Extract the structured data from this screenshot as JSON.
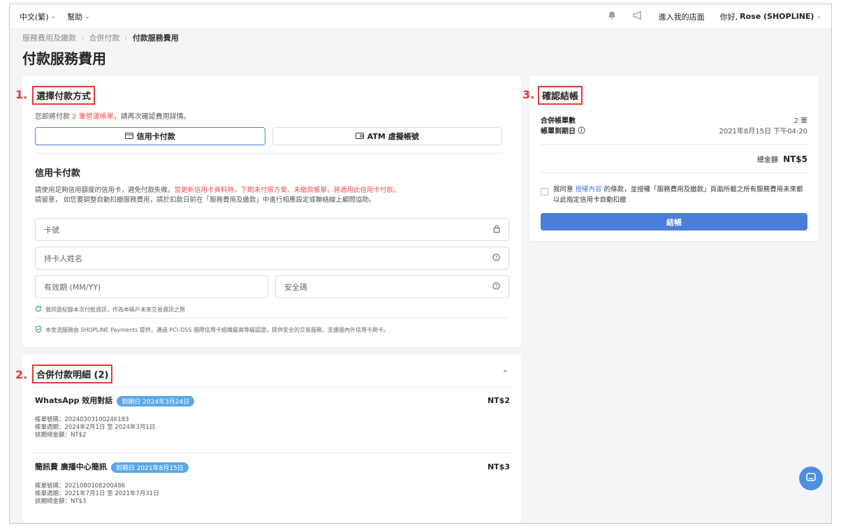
{
  "topbar": {
    "language": "中文(繁)",
    "help": "幫助",
    "enter_store": "進入我的店面",
    "greeting": "你好, ",
    "user": "Rose (SHOPLINE)"
  },
  "breadcrumb": [
    "服務費用及繳款",
    "合併付款",
    "付款服務費用"
  ],
  "page_title": "付款服務費用",
  "step1": {
    "num": "1.",
    "title": "選擇付款方式",
    "hint_pre": "您即將付款 ",
    "hint_count": "2 筆營運帳單",
    "hint_post": "，請再次確認費用詳情。",
    "tab_card": "信用卡付款",
    "tab_atm": "ATM 虛擬帳號",
    "section_title": "信用卡付款",
    "notice1_pre": "請使用足夠信用額度的信用卡，避免付款失敗。",
    "notice1_red": "當更新信用卡資料時，下期未付賬方案、未繳款帳單，將適用此信用卡付款。",
    "notice2": "請留意， 如您要調整自動扣繳服務費用，請於扣款日前在「服務費用及繳款」中進行相應設定或聯絡線上顧問協助。",
    "card_number": "卡號",
    "holder_name": "持卡人姓名",
    "expiry": "有效期 (MM/YY)",
    "cvc": "安全碼",
    "remember": "我同意紀錄本次付款資訊，作為本帳戶未來交易資訊之用",
    "provider": "本金流服務由 SHOPLINE Payments 提供，通過 PCI-DSS 國際信用卡組織最高等級認證，提供安全的交易服務，支援國內外信用卡刷卡。"
  },
  "step2": {
    "num": "2.",
    "title": "合併付款明細 (2)",
    "items": [
      {
        "name": "WhatsApp 效用對話",
        "badge": "到期日 2024年3月24日",
        "amount": "NT$2",
        "bill_no": "帳單號碼：20240303100246183",
        "period": "帳單週期：2024年2月1日 至 2024年3月1日",
        "total": "該期總金額：NT$2"
      },
      {
        "name": "簡訊費 廣播中心簡訊",
        "badge": "到期日 2021年8月15日",
        "amount": "NT$3",
        "bill_no": "帳單號碼：2021080108200486",
        "period": "帳單週期：2021年7月1日 至 2021年7月31日",
        "total": "該期總金額：NT$3"
      }
    ]
  },
  "step3": {
    "num": "3.",
    "title": "確認結帳",
    "merged_label": "合併帳單數",
    "merged_value": "2 筆",
    "due_label": "帳單到期日",
    "due_value": "2021年8月15日 下午04:20",
    "total_label": "總金額",
    "total_value": "NT$5",
    "agree_pre": "我同意 ",
    "agree_link": "授權內容",
    "agree_post": " 的條款，並授權「服務費用及繳款」頁面所載之所有服務費用未來都以此指定信用卡自動扣繳",
    "checkout": "結帳"
  },
  "colors": {
    "accent": "#4a7fd9",
    "annotation_red": "#e53935",
    "badge_blue": "#5aa8e6",
    "warn_red": "#ef5350",
    "safe_green": "#2eaa5f"
  }
}
